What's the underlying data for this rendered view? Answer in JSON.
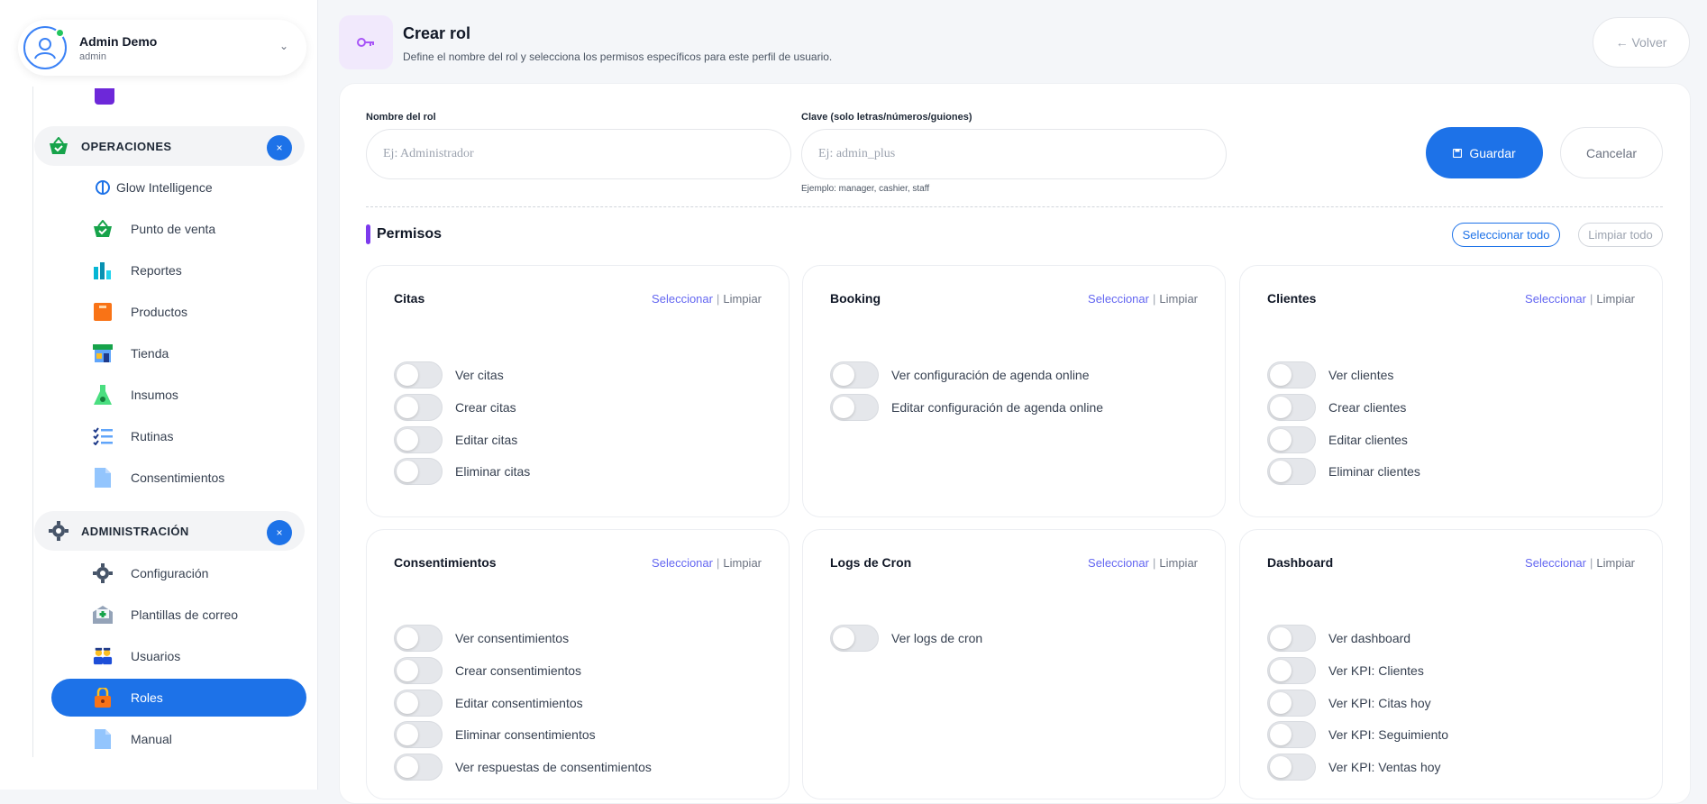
{
  "user": {
    "name": "Admin Demo",
    "role": "admin"
  },
  "sidebar": {
    "sections": [
      {
        "label": "OPERACIONES",
        "close": "×"
      },
      {
        "label": "ADMINISTRACIÓN",
        "close": "×"
      }
    ],
    "operaciones_items": [
      {
        "label": "Glow Intelligence",
        "icon": "brain-icon"
      },
      {
        "label": "Punto de venta",
        "icon": "basket-icon"
      },
      {
        "label": "Reportes",
        "icon": "bar-chart-icon"
      },
      {
        "label": "Productos",
        "icon": "box-icon"
      },
      {
        "label": "Tienda",
        "icon": "store-icon"
      },
      {
        "label": "Insumos",
        "icon": "flask-icon"
      },
      {
        "label": "Rutinas",
        "icon": "checklist-icon"
      },
      {
        "label": "Consentimientos",
        "icon": "document-icon"
      }
    ],
    "admin_items": [
      {
        "label": "Configuración",
        "icon": "gear-icon"
      },
      {
        "label": "Plantillas de correo",
        "icon": "mail-template-icon"
      },
      {
        "label": "Usuarios",
        "icon": "users-icon"
      },
      {
        "label": "Roles",
        "icon": "lock-icon",
        "active": true
      },
      {
        "label": "Manual",
        "icon": "document-icon"
      }
    ]
  },
  "header": {
    "title": "Crear rol",
    "subtitle": "Define el nombre del rol y selecciona los permisos específicos para este perfil de usuario.",
    "back_label": "← Volver"
  },
  "form": {
    "name_label": "Nombre del rol",
    "name_placeholder": "Ej: Administrador",
    "key_label": "Clave (solo letras/números/guiones)",
    "key_placeholder": "Ej: admin_plus",
    "key_hint": "Ejemplo: manager, cashier, staff",
    "save_label": "Guardar",
    "cancel_label": "Cancelar"
  },
  "permissions": {
    "title": "Permisos",
    "select_all": "Seleccionar todo",
    "clear_all": "Limpiar todo",
    "select_label": "Seleccionar",
    "clear_label": "Limpiar",
    "groups": [
      {
        "title": "Citas",
        "items": [
          "Ver citas",
          "Crear citas",
          "Editar citas",
          "Eliminar citas"
        ]
      },
      {
        "title": "Booking",
        "items": [
          "Ver configuración de agenda online",
          "Editar configuración de agenda online"
        ]
      },
      {
        "title": "Clientes",
        "items": [
          "Ver clientes",
          "Crear clientes",
          "Editar clientes",
          "Eliminar clientes"
        ]
      },
      {
        "title": "Consentimientos",
        "items": [
          "Ver consentimientos",
          "Crear consentimientos",
          "Editar consentimientos",
          "Eliminar consentimientos",
          "Ver respuestas de consentimientos"
        ]
      },
      {
        "title": "Logs de Cron",
        "items": [
          "Ver logs de cron"
        ]
      },
      {
        "title": "Dashboard",
        "items": [
          "Ver dashboard",
          "Ver KPI: Clientes",
          "Ver KPI: Citas hoy",
          "Ver KPI: Seguimiento",
          "Ver KPI: Ventas hoy"
        ]
      }
    ]
  },
  "colors": {
    "accent": "#1d72e8",
    "purple": "#7c3aed",
    "link": "#6366f1"
  }
}
